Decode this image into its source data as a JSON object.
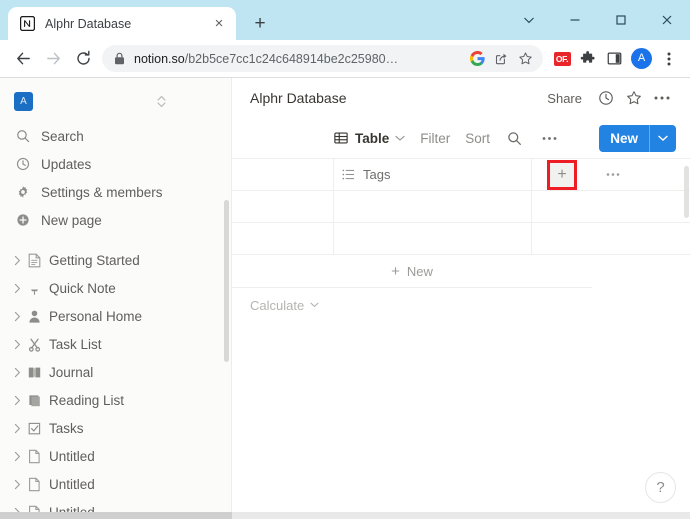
{
  "browser": {
    "tab": {
      "title": "Alphr Database",
      "favicon": "notion-icon",
      "close": "×"
    },
    "new_tab_label": "+",
    "window_controls": [
      {
        "name": "chevron-down",
        "glyph": "⌄"
      },
      {
        "name": "minimize",
        "glyph": "–"
      },
      {
        "name": "maximize",
        "glyph": "□"
      },
      {
        "name": "close",
        "glyph": "✕"
      }
    ],
    "nav": {
      "back": "←",
      "forward": "→",
      "reload": "↻"
    },
    "omnibox": {
      "lock": "lock-icon",
      "url_domain": "notion.so",
      "url_path": "/b2b5ce7cc1c24c648914be2c25980…",
      "google_icon": "G",
      "share_icon": "share-icon",
      "bookmark_icon": "star-icon"
    },
    "extensions": {
      "of_badge": "OF.",
      "puzzle": "puzzle-icon",
      "sidepanel": "side-panel-icon",
      "profile_initial": "A",
      "menu": "kebab-menu-icon"
    }
  },
  "sidebar": {
    "workspace": {
      "initial": "A",
      "switcher_icon": "chevron-updown-icon"
    },
    "nav_items": [
      {
        "label": "Search",
        "icon": "search-icon"
      },
      {
        "label": "Updates",
        "icon": "clock-icon"
      },
      {
        "label": "Settings & members",
        "icon": "gear-icon"
      },
      {
        "label": "New page",
        "icon": "plus-circle-icon"
      }
    ],
    "pages": [
      {
        "label": "Getting Started",
        "icon": "document-icon"
      },
      {
        "label": "Quick Note",
        "icon": "pushpin-icon"
      },
      {
        "label": "Personal Home",
        "icon": "person-icon"
      },
      {
        "label": "Task List",
        "icon": "scissors-icon"
      },
      {
        "label": "Journal",
        "icon": "book-icon"
      },
      {
        "label": "Reading List",
        "icon": "books-icon"
      },
      {
        "label": "Tasks",
        "icon": "checkbox-icon"
      },
      {
        "label": "Untitled",
        "icon": "document-icon"
      },
      {
        "label": "Untitled",
        "icon": "document-icon"
      },
      {
        "label": "Untitled",
        "icon": "document-icon"
      }
    ]
  },
  "main": {
    "page_title": "Alphr Database",
    "header_actions": {
      "share": "Share",
      "updates_icon": "clock-icon",
      "favorite_icon": "star-icon",
      "more_icon": "ellipsis-icon"
    },
    "view_toolbar": {
      "view_name": "Table",
      "view_icon": "table-icon",
      "view_chevron": "⌄",
      "filter": "Filter",
      "sort": "Sort",
      "search_icon": "search-icon",
      "more_icon": "ellipsis-icon",
      "new_button": "New",
      "new_button_chevron": "⌄"
    },
    "table": {
      "columns": [
        {
          "label": "",
          "icon": ""
        },
        {
          "label": "Tags",
          "icon": "multi-select-icon"
        }
      ],
      "add_column_button": "+",
      "row_menu_icon": "ellipsis-icon",
      "rows": [
        {
          "cells": [
            "",
            ""
          ]
        },
        {
          "cells": [
            "",
            ""
          ]
        }
      ],
      "new_row_label": "New",
      "new_row_plus": "+",
      "calculate_label": "Calculate",
      "calculate_chevron": "⌄"
    },
    "help_button": "?"
  },
  "colors": {
    "tabstrip": "#bfe4f2",
    "accent_blue": "#2383e2",
    "highlight_red": "#ee1c25",
    "sidebar_bg": "#fbfbfa"
  }
}
